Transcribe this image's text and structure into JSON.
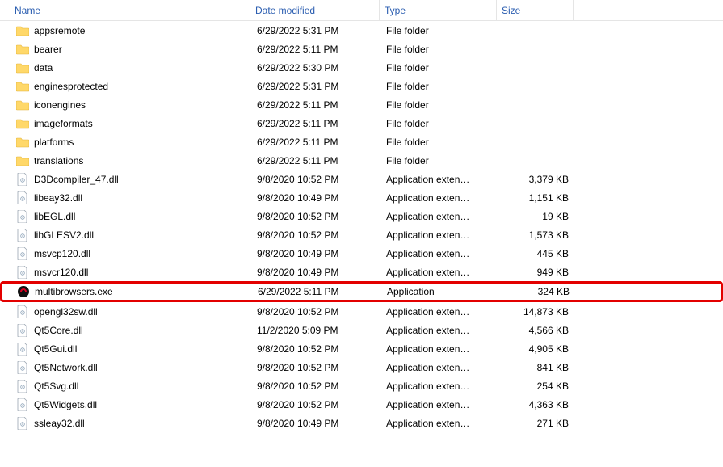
{
  "columns": {
    "name": "Name",
    "date": "Date modified",
    "type": "Type",
    "size": "Size"
  },
  "rows": [
    {
      "icon": "folder",
      "name": "appsremote",
      "date": "6/29/2022 5:31 PM",
      "type": "File folder",
      "size": "",
      "highlight": false
    },
    {
      "icon": "folder",
      "name": "bearer",
      "date": "6/29/2022 5:11 PM",
      "type": "File folder",
      "size": "",
      "highlight": false
    },
    {
      "icon": "folder",
      "name": "data",
      "date": "6/29/2022 5:30 PM",
      "type": "File folder",
      "size": "",
      "highlight": false
    },
    {
      "icon": "folder",
      "name": "enginesprotected",
      "date": "6/29/2022 5:31 PM",
      "type": "File folder",
      "size": "",
      "highlight": false
    },
    {
      "icon": "folder",
      "name": "iconengines",
      "date": "6/29/2022 5:11 PM",
      "type": "File folder",
      "size": "",
      "highlight": false
    },
    {
      "icon": "folder",
      "name": "imageformats",
      "date": "6/29/2022 5:11 PM",
      "type": "File folder",
      "size": "",
      "highlight": false
    },
    {
      "icon": "folder",
      "name": "platforms",
      "date": "6/29/2022 5:11 PM",
      "type": "File folder",
      "size": "",
      "highlight": false
    },
    {
      "icon": "folder",
      "name": "translations",
      "date": "6/29/2022 5:11 PM",
      "type": "File folder",
      "size": "",
      "highlight": false
    },
    {
      "icon": "file",
      "name": "D3Dcompiler_47.dll",
      "date": "9/8/2020 10:52 PM",
      "type": "Application exten…",
      "size": "3,379 KB",
      "highlight": false
    },
    {
      "icon": "file",
      "name": "libeay32.dll",
      "date": "9/8/2020 10:49 PM",
      "type": "Application exten…",
      "size": "1,151 KB",
      "highlight": false
    },
    {
      "icon": "file",
      "name": "libEGL.dll",
      "date": "9/8/2020 10:52 PM",
      "type": "Application exten…",
      "size": "19 KB",
      "highlight": false
    },
    {
      "icon": "file",
      "name": "libGLESV2.dll",
      "date": "9/8/2020 10:52 PM",
      "type": "Application exten…",
      "size": "1,573 KB",
      "highlight": false
    },
    {
      "icon": "file",
      "name": "msvcp120.dll",
      "date": "9/8/2020 10:49 PM",
      "type": "Application exten…",
      "size": "445 KB",
      "highlight": false
    },
    {
      "icon": "file",
      "name": "msvcr120.dll",
      "date": "9/8/2020 10:49 PM",
      "type": "Application exten…",
      "size": "949 KB",
      "highlight": false
    },
    {
      "icon": "exe",
      "name": "multibrowsers.exe",
      "date": "6/29/2022 5:11 PM",
      "type": "Application",
      "size": "324 KB",
      "highlight": true
    },
    {
      "icon": "file",
      "name": "opengl32sw.dll",
      "date": "9/8/2020 10:52 PM",
      "type": "Application exten…",
      "size": "14,873 KB",
      "highlight": false
    },
    {
      "icon": "file",
      "name": "Qt5Core.dll",
      "date": "11/2/2020 5:09 PM",
      "type": "Application exten…",
      "size": "4,566 KB",
      "highlight": false
    },
    {
      "icon": "file",
      "name": "Qt5Gui.dll",
      "date": "9/8/2020 10:52 PM",
      "type": "Application exten…",
      "size": "4,905 KB",
      "highlight": false
    },
    {
      "icon": "file",
      "name": "Qt5Network.dll",
      "date": "9/8/2020 10:52 PM",
      "type": "Application exten…",
      "size": "841 KB",
      "highlight": false
    },
    {
      "icon": "file",
      "name": "Qt5Svg.dll",
      "date": "9/8/2020 10:52 PM",
      "type": "Application exten…",
      "size": "254 KB",
      "highlight": false
    },
    {
      "icon": "file",
      "name": "Qt5Widgets.dll",
      "date": "9/8/2020 10:52 PM",
      "type": "Application exten…",
      "size": "4,363 KB",
      "highlight": false
    },
    {
      "icon": "file",
      "name": "ssleay32.dll",
      "date": "9/8/2020 10:49 PM",
      "type": "Application exten…",
      "size": "271 KB",
      "highlight": false
    }
  ]
}
